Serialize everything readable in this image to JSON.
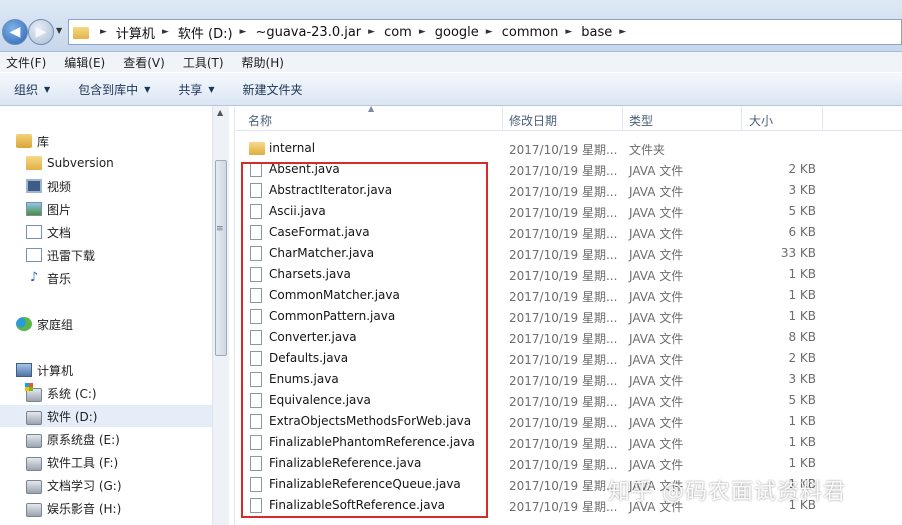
{
  "address": {
    "breadcrumbs": [
      "计算机",
      "软件 (D:)",
      "~guava-23.0.jar",
      "com",
      "google",
      "common",
      "base"
    ]
  },
  "menu": [
    "文件(F)",
    "编辑(E)",
    "查看(V)",
    "工具(T)",
    "帮助(H)"
  ],
  "toolbar": [
    "组织",
    "包含到库中",
    "共享",
    "新建文件夹"
  ],
  "sidebar": {
    "libraries": {
      "label": "库",
      "items": [
        "Subversion",
        "视频",
        "图片",
        "文档",
        "迅雷下载",
        "音乐"
      ]
    },
    "homegroup": "家庭组",
    "computer": {
      "label": "计算机",
      "items": [
        "系统 (C:)",
        "软件 (D:)",
        "原系统盘 (E:)",
        "软件工具 (F:)",
        "文档学习 (G:)",
        "娱乐影音 (H:)"
      ]
    }
  },
  "columns": [
    "名称",
    "修改日期",
    "类型",
    "大小"
  ],
  "files": [
    {
      "name": "internal",
      "date": "2017/10/19 星期...",
      "type": "文件夹",
      "size": "",
      "folder": true
    },
    {
      "name": "Absent.java",
      "date": "2017/10/19 星期...",
      "type": "JAVA 文件",
      "size": "2 KB"
    },
    {
      "name": "AbstractIterator.java",
      "date": "2017/10/19 星期...",
      "type": "JAVA 文件",
      "size": "3 KB"
    },
    {
      "name": "Ascii.java",
      "date": "2017/10/19 星期...",
      "type": "JAVA 文件",
      "size": "5 KB"
    },
    {
      "name": "CaseFormat.java",
      "date": "2017/10/19 星期...",
      "type": "JAVA 文件",
      "size": "6 KB"
    },
    {
      "name": "CharMatcher.java",
      "date": "2017/10/19 星期...",
      "type": "JAVA 文件",
      "size": "33 KB"
    },
    {
      "name": "Charsets.java",
      "date": "2017/10/19 星期...",
      "type": "JAVA 文件",
      "size": "1 KB"
    },
    {
      "name": "CommonMatcher.java",
      "date": "2017/10/19 星期...",
      "type": "JAVA 文件",
      "size": "1 KB"
    },
    {
      "name": "CommonPattern.java",
      "date": "2017/10/19 星期...",
      "type": "JAVA 文件",
      "size": "1 KB"
    },
    {
      "name": "Converter.java",
      "date": "2017/10/19 星期...",
      "type": "JAVA 文件",
      "size": "8 KB"
    },
    {
      "name": "Defaults.java",
      "date": "2017/10/19 星期...",
      "type": "JAVA 文件",
      "size": "2 KB"
    },
    {
      "name": "Enums.java",
      "date": "2017/10/19 星期...",
      "type": "JAVA 文件",
      "size": "3 KB"
    },
    {
      "name": "Equivalence.java",
      "date": "2017/10/19 星期...",
      "type": "JAVA 文件",
      "size": "5 KB"
    },
    {
      "name": "ExtraObjectsMethodsForWeb.java",
      "date": "2017/10/19 星期...",
      "type": "JAVA 文件",
      "size": "1 KB"
    },
    {
      "name": "FinalizablePhantomReference.java",
      "date": "2017/10/19 星期...",
      "type": "JAVA 文件",
      "size": "1 KB"
    },
    {
      "name": "FinalizableReference.java",
      "date": "2017/10/19 星期...",
      "type": "JAVA 文件",
      "size": "1 KB"
    },
    {
      "name": "FinalizableReferenceQueue.java",
      "date": "2017/10/19 星期...",
      "type": "JAVA 文件",
      "size": "1 KB"
    },
    {
      "name": "FinalizableSoftReference.java",
      "date": "2017/10/19 星期...",
      "type": "JAVA 文件",
      "size": "1 KB"
    }
  ],
  "watermark": "知乎 @码农面试资料君",
  "colors": {
    "highlight": "#d42b2b",
    "selected_nav": "#e5eef8"
  }
}
